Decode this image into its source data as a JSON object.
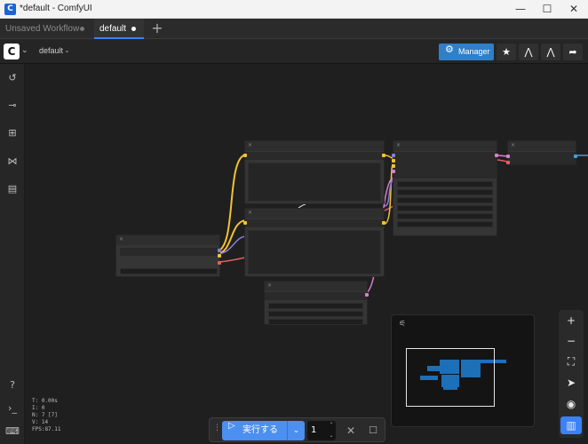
{
  "window": {
    "app_icon": "C",
    "title": "*default - ComfyUI",
    "minimize": "—",
    "maximize": "☐",
    "close": "✕"
  },
  "tabs": [
    {
      "label": "Unsaved Workflow",
      "active": false
    },
    {
      "label": "default",
      "active": true
    }
  ],
  "add_tab": "+",
  "toolbar": {
    "logo": "C",
    "logo_chevron": "⌄",
    "workflow_name": "default",
    "workflow_chevron": "⌄",
    "manager_label": "Manager",
    "manager_icon": "puzzle-icon"
  },
  "toolbar_icons": [
    "star-icon",
    "model-icon",
    "model-alt-icon",
    "share-icon"
  ],
  "sidebar_icons": [
    "history-icon",
    "queue-icon",
    "node-library-icon",
    "model-library-icon",
    "workflows-icon",
    "help-icon",
    "terminal-icon",
    "keyboard-icon"
  ],
  "stats": {
    "t": "T: 0.00s",
    "i": "I: 0",
    "n": "N: 7 [7]",
    "v": "V: 14",
    "fps": "FPS:87.11"
  },
  "controls": [
    "zoom-in",
    "zoom-out",
    "fit-view",
    "select-mode",
    "toggle-links",
    "toggle-minimap"
  ],
  "runbar": {
    "run_label": "実行する",
    "run_icon": "▷",
    "chevron": "⌄",
    "count": "1",
    "cancel": "✕",
    "stop": "☐"
  },
  "colors": {
    "accent": "#3b82f6",
    "manager": "#2f7fc9",
    "link_yellow": "#f1c232",
    "link_red": "#e25e5e",
    "link_pink": "#d77fd0",
    "link_purple": "#8a7cd8",
    "link_blue": "#3aa0e8",
    "minimap_node": "#1d6fb8"
  }
}
